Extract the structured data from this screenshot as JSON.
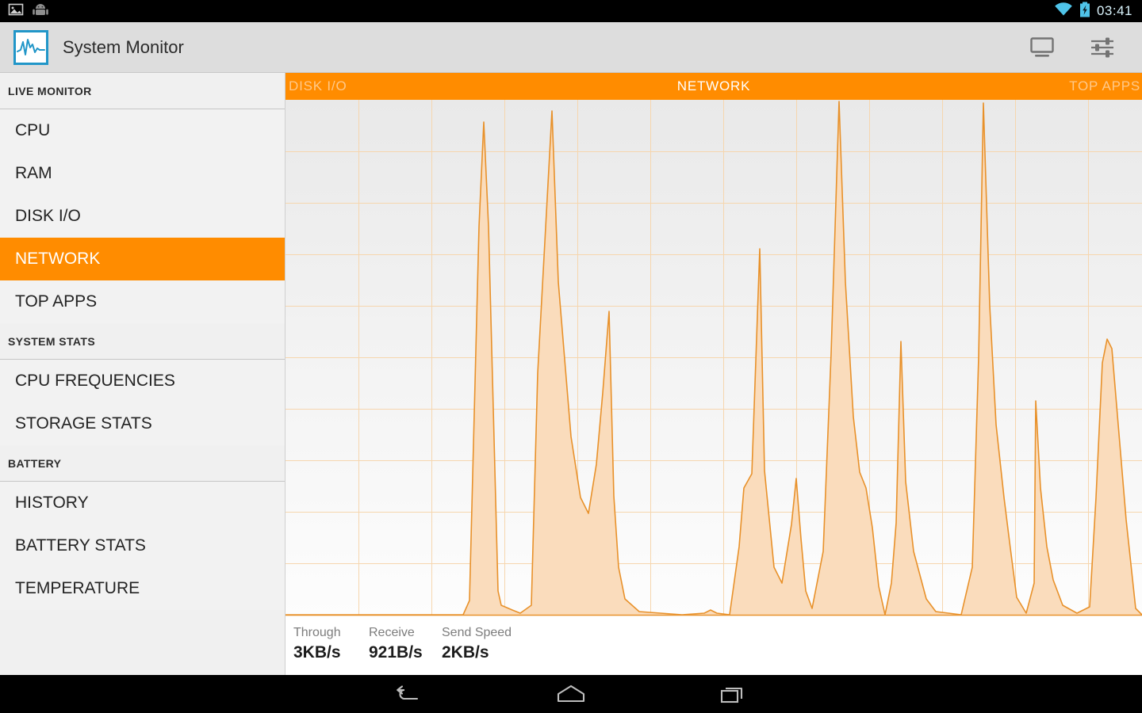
{
  "statusbar": {
    "icons": [
      "image-icon",
      "android-robot-icon",
      "wifi-icon",
      "battery-charging-icon"
    ],
    "clock": "03:41"
  },
  "actionbar": {
    "app_icon": "waveform-app-icon",
    "title": "System Monitor",
    "actions": [
      {
        "name": "display-icon",
        "label": "Display"
      },
      {
        "name": "settings-sliders-icon",
        "label": "Settings"
      }
    ]
  },
  "sidebar": {
    "sections": [
      {
        "header": "LIVE MONITOR",
        "items": [
          {
            "label": "CPU",
            "active": false
          },
          {
            "label": "RAM",
            "active": false
          },
          {
            "label": "DISK I/O",
            "active": false
          },
          {
            "label": "NETWORK",
            "active": true
          },
          {
            "label": "TOP APPS",
            "active": false
          }
        ]
      },
      {
        "header": "SYSTEM STATS",
        "items": [
          {
            "label": "CPU FREQUENCIES",
            "active": false
          },
          {
            "label": "STORAGE STATS",
            "active": false
          }
        ]
      },
      {
        "header": "BATTERY",
        "items": [
          {
            "label": "HISTORY",
            "active": false
          },
          {
            "label": "BATTERY STATS",
            "active": false
          },
          {
            "label": "TEMPERATURE",
            "active": false
          }
        ]
      }
    ]
  },
  "tabs": {
    "left": "DISK I/O",
    "current": "NETWORK",
    "right": "TOP APPS"
  },
  "stats": [
    {
      "label": "Through",
      "value": "3KB/s"
    },
    {
      "label": "Receive",
      "value": "921B/s"
    },
    {
      "label": "Send Speed",
      "value": "2KB/s"
    }
  ],
  "navbar": {
    "buttons": [
      {
        "name": "back-icon",
        "label": "Back"
      },
      {
        "name": "home-icon",
        "label": "Home"
      },
      {
        "name": "recents-icon",
        "label": "Recents"
      }
    ]
  },
  "colors": {
    "accent_orange": "#ff8c00",
    "chart_stroke": "#e8912a",
    "chart_fill": "#fadcbc",
    "grid_line": "#f6d6ae",
    "sidebar_bg": "#f0f0f0",
    "actionbar_bg": "#dddddd",
    "app_icon_blue": "#2196c8"
  },
  "chart_data": {
    "type": "area",
    "title": "NETWORK",
    "xlabel": "",
    "ylabel": "",
    "grid": true,
    "legend": "none",
    "xlim": [
      0,
      1080
    ],
    "ylim": [
      0,
      650
    ],
    "note": "Network throughput live area chart; y measured as pixel height above baseline, baseline=0 at bottom of plot",
    "x_gridline_spacing": 92,
    "y_gridline_spacing": 65,
    "points": [
      [
        0,
        0
      ],
      [
        224,
        0
      ],
      [
        232,
        18
      ],
      [
        244,
        490
      ],
      [
        250,
        622
      ],
      [
        256,
        490
      ],
      [
        268,
        30
      ],
      [
        272,
        12
      ],
      [
        286,
        6
      ],
      [
        296,
        2
      ],
      [
        310,
        12
      ],
      [
        318,
        305
      ],
      [
        336,
        636
      ],
      [
        344,
        420
      ],
      [
        360,
        225
      ],
      [
        372,
        148
      ],
      [
        382,
        128
      ],
      [
        392,
        190
      ],
      [
        400,
        280
      ],
      [
        408,
        383
      ],
      [
        414,
        150
      ],
      [
        420,
        60
      ],
      [
        428,
        20
      ],
      [
        446,
        4
      ],
      [
        500,
        0
      ],
      [
        528,
        2
      ],
      [
        536,
        6
      ],
      [
        544,
        2
      ],
      [
        560,
        0
      ],
      [
        572,
        86
      ],
      [
        578,
        160
      ],
      [
        588,
        178
      ],
      [
        598,
        462
      ],
      [
        604,
        182
      ],
      [
        616,
        60
      ],
      [
        626,
        40
      ],
      [
        638,
        114
      ],
      [
        644,
        172
      ],
      [
        650,
        96
      ],
      [
        656,
        30
      ],
      [
        664,
        8
      ],
      [
        678,
        80
      ],
      [
        688,
        330
      ],
      [
        698,
        648
      ],
      [
        706,
        420
      ],
      [
        716,
        250
      ],
      [
        724,
        180
      ],
      [
        732,
        160
      ],
      [
        740,
        110
      ],
      [
        748,
        36
      ],
      [
        756,
        0
      ],
      [
        764,
        40
      ],
      [
        770,
        116
      ],
      [
        776,
        345
      ],
      [
        782,
        168
      ],
      [
        792,
        80
      ],
      [
        808,
        20
      ],
      [
        820,
        4
      ],
      [
        852,
        0
      ],
      [
        866,
        60
      ],
      [
        874,
        325
      ],
      [
        880,
        646
      ],
      [
        888,
        390
      ],
      [
        896,
        240
      ],
      [
        906,
        148
      ],
      [
        914,
        84
      ],
      [
        922,
        22
      ],
      [
        934,
        2
      ],
      [
        944,
        40
      ],
      [
        946,
        270
      ],
      [
        952,
        160
      ],
      [
        960,
        86
      ],
      [
        968,
        44
      ],
      [
        980,
        12
      ],
      [
        998,
        2
      ],
      [
        1014,
        10
      ],
      [
        1022,
        148
      ],
      [
        1030,
        318
      ],
      [
        1036,
        348
      ],
      [
        1042,
        336
      ],
      [
        1050,
        240
      ],
      [
        1060,
        120
      ],
      [
        1072,
        8
      ],
      [
        1080,
        0
      ]
    ]
  }
}
